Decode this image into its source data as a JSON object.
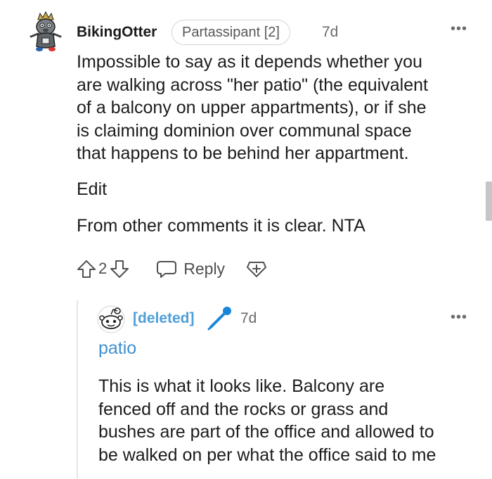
{
  "comment": {
    "author": "BikingOtter",
    "flair": "Partassipant [2]",
    "time": "7d",
    "more": "•••",
    "body_lines": [
      "Impossible to say as it depends whether you",
      "are walking across \"her patio\" (the equivalent",
      "of a balcony on upper appartments), or if she",
      "is claiming dominion over communal space",
      "that happens to be behind her appartment."
    ],
    "edit_label": "Edit",
    "edit_text": "From other comments it is clear. NTA",
    "score": "2",
    "reply_label": "Reply"
  },
  "reply": {
    "author": "[deleted]",
    "time": "7d",
    "more": "•••",
    "flair": "patio",
    "body_lines": [
      "This is what it looks like. Balcony are",
      "fenced off and the rocks or grass and",
      "bushes are part of the office and allowed to",
      "be walked on per what the office said to me"
    ]
  },
  "colors": {
    "deleted_author": "#4fa0d8",
    "mic_icon": "#1a86d8",
    "thread_line": "#e6e6e6"
  },
  "icons": {
    "avatar1": "otter-avatar-icon",
    "avatar2": "snoo-avatar-icon",
    "upvote": "upvote-arrow-icon",
    "downvote": "downvote-arrow-icon",
    "reply": "speech-bubble-icon",
    "award": "award-plus-icon",
    "mic": "microphone-icon"
  }
}
